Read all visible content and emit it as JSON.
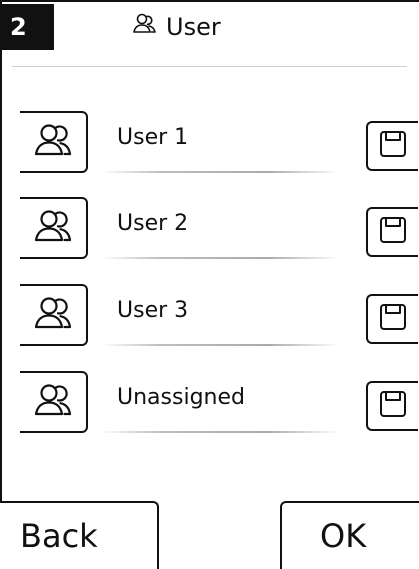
{
  "header": {
    "badge": "2",
    "title_icon": "user-icon",
    "title": "User"
  },
  "users": [
    {
      "label": "User 1",
      "icon": "user-icon",
      "save_icon": "save-icon"
    },
    {
      "label": "User 2",
      "icon": "user-icon",
      "save_icon": "save-icon"
    },
    {
      "label": "User 3",
      "icon": "user-icon",
      "save_icon": "save-icon"
    },
    {
      "label": "Unassigned",
      "icon": "user-icon",
      "save_icon": "save-icon"
    }
  ],
  "footer": {
    "back_label": "Back",
    "ok_label": "OK"
  }
}
